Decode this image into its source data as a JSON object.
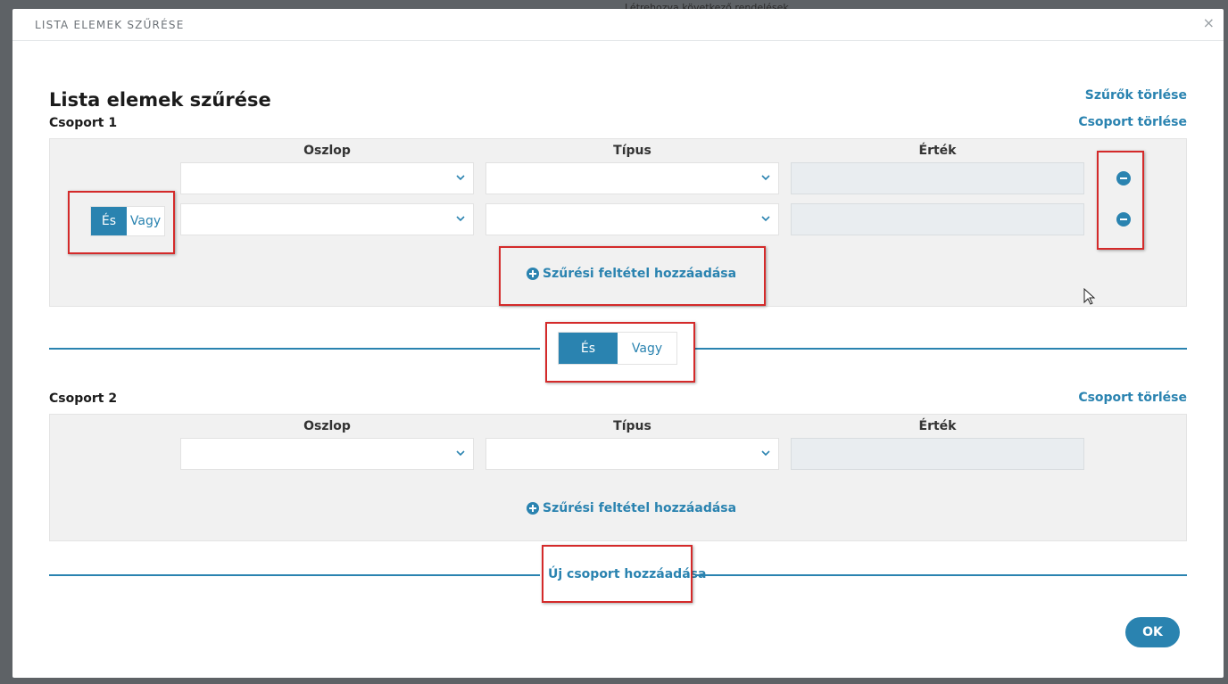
{
  "background": {
    "snippet": "Létrehozva következő rendelések"
  },
  "dialog": {
    "title": "LISTA ELEMEK SZŰRÉSE",
    "close": "×",
    "heading": "Lista elemek szűrése",
    "clear_filters": "Szűrők törlése",
    "groups": [
      {
        "label": "Csoport 1",
        "delete": "Csoport törlése",
        "columns": {
          "column": "Oszlop",
          "type": "Típus",
          "value": "Érték"
        },
        "toggle": {
          "and": "És",
          "or": "Vagy",
          "selected": "És"
        },
        "add_condition": "Szűrési feltétel hozzáadása"
      },
      {
        "label": "Csoport 2",
        "delete": "Csoport törlése",
        "columns": {
          "column": "Oszlop",
          "type": "Típus",
          "value": "Érték"
        },
        "add_condition": "Szűrési feltétel hozzáadása"
      }
    ],
    "between_groups_toggle": {
      "and": "És",
      "or": "Vagy",
      "selected": "És"
    },
    "add_group": "Új csoport hozzáadása",
    "ok": "OK"
  },
  "colors": {
    "accent": "#2a83b0",
    "highlight": "#d42a2a"
  }
}
